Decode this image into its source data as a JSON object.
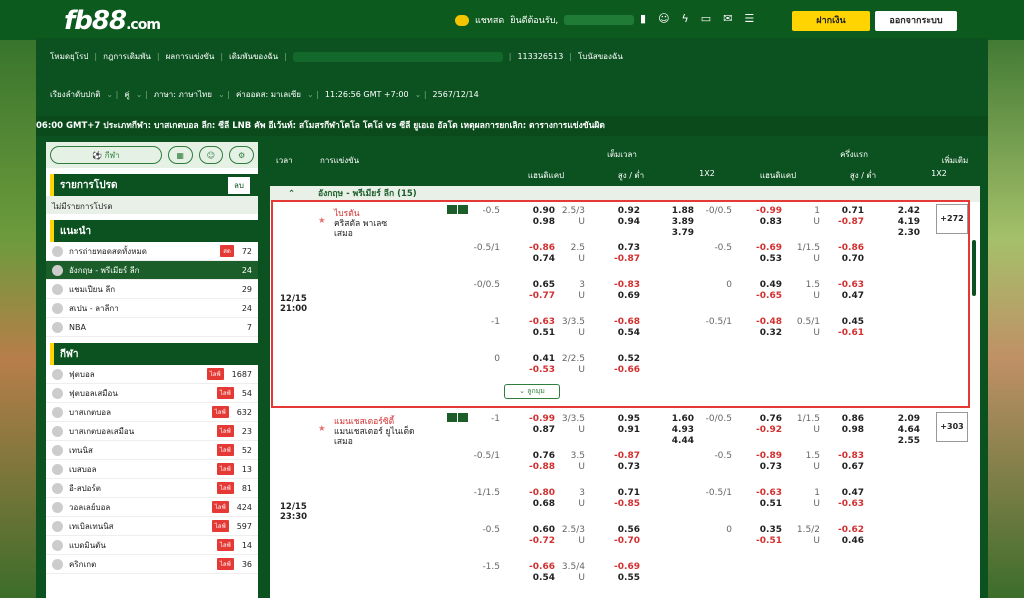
{
  "header": {
    "logo": "fb88",
    "logo_suffix": ".com",
    "chat": "แชทสด",
    "greeting": "ยินดีต้อนรับ,",
    "deposit": "ฝากเงิน",
    "logout": "ออกจากระบบ"
  },
  "nav1": [
    "โหมดยุโรป",
    "กฎการเดิมพัน",
    "ผลการแข่งขัน",
    "เดิมพันของฉัน",
    "113326513",
    "โบนัสของฉัน"
  ],
  "nav2": [
    "เรียงลำดับปกติ",
    "คู่",
    "ภาษา: ภาษาไทย",
    "ค่าออดส: มาเลเซีย",
    "11:26:56 GMT +7:00",
    "2567/12/14"
  ],
  "ticker": "06:00 GMT+7 ประเภทกีฬา: บาสเกตบอล ลีก: ซีลี LNB คัพ อีเว้นท์: สโมสรกีฬาโคโล โคโล่ vs ซีลี ยูเอเอ อัลโต เหตุผลการยกเลิก: ตารางการแข่งขันผิด",
  "sidebar": {
    "sport_btn": "กีฬา",
    "favorites_title": "รายการโปรด",
    "delete": "ลบ",
    "no_favorites": "ไม่มีรายการโปรด",
    "recommend_title": "แนะนำ",
    "recommend": [
      {
        "label": "การถ่ายทอดสดทั้งหมด",
        "tag": "สด",
        "count": "72"
      },
      {
        "label": "อังกฤษ - พรีเมียร์ ลีก",
        "count": "24"
      },
      {
        "label": "แชมเปียน ลีก",
        "count": "29"
      },
      {
        "label": "สเปน - ลาลีกา",
        "count": "24"
      },
      {
        "label": "NBA",
        "count": "7"
      }
    ],
    "sports_title": "กีฬา",
    "sports": [
      {
        "label": "ฟุตบอล",
        "tag": "ไลฟ์",
        "count": "1687"
      },
      {
        "label": "ฟุตบอลเสมือน",
        "tag": "ไลฟ์",
        "count": "54"
      },
      {
        "label": "บาสเกตบอล",
        "tag": "ไลฟ์",
        "count": "632"
      },
      {
        "label": "บาสเกตบอลเสมือน",
        "tag": "ไลฟ์",
        "count": "23"
      },
      {
        "label": "เทนนิส",
        "tag": "ไลฟ์",
        "count": "52"
      },
      {
        "label": "เบสบอล",
        "tag": "ไลฟ์",
        "count": "13"
      },
      {
        "label": "อี-สปอร์ต",
        "tag": "ไลฟ์",
        "count": "81"
      },
      {
        "label": "วอลเลย์บอล",
        "tag": "ไลฟ์",
        "count": "424"
      },
      {
        "label": "เทเบิลเทนนิส",
        "tag": "ไลฟ์",
        "count": "597"
      },
      {
        "label": "แบดมินตัน",
        "tag": "ไลฟ์",
        "count": "14"
      },
      {
        "label": "คริกเกต",
        "tag": "ไลฟ์",
        "count": "36"
      }
    ]
  },
  "table": {
    "time": "เวลา",
    "match": "การแข่งขัน",
    "fulltime": "เต็มเวลา",
    "halftime": "ครึ่งแรก",
    "more": "เพิ่มเติม",
    "hdp": "แฮนดิแคป",
    "ou": "สูง / ต่ำ",
    "x12": "1X2",
    "league": "อังกฤษ - พรีเมียร์ ลีก (15)",
    "more_btn": "ลูกมุม"
  },
  "match1": {
    "date": "12/15",
    "time": "21:00",
    "home": "ไบรตัน",
    "away": "คริสตัล พาเลซ",
    "draw": "เสมอ",
    "plus": "+272",
    "rows": [
      [
        "-0.5",
        "0.90",
        "0.98",
        "2.5/3",
        "U",
        "0.92",
        "0.94",
        "1.88",
        "3.89",
        "3.79",
        "-0/0.5",
        "-0.99",
        "0.83",
        "1",
        "U",
        "0.71",
        "-0.87",
        "2.42",
        "4.19",
        "2.30"
      ],
      [
        "-0.5/1",
        "-0.86",
        "0.74",
        "2.5",
        "U",
        "0.73",
        "-0.87",
        "",
        "",
        "",
        "-0.5",
        "-0.69",
        "0.53",
        "1/1.5",
        "U",
        "-0.86",
        "0.70",
        "",
        "",
        ""
      ],
      [
        "-0/0.5",
        "0.65",
        "-0.77",
        "3",
        "U",
        "-0.83",
        "0.69",
        "",
        "",
        "",
        "0",
        "0.49",
        "-0.65",
        "1.5",
        "U",
        "-0.63",
        "0.47",
        "",
        "",
        ""
      ],
      [
        "-1",
        "-0.63",
        "0.51",
        "3/3.5",
        "U",
        "-0.68",
        "0.54",
        "",
        "",
        "",
        "-0.5/1",
        "-0.48",
        "0.32",
        "0.5/1",
        "U",
        "0.45",
        "-0.61",
        "",
        "",
        ""
      ],
      [
        "0",
        "0.41",
        "-0.53",
        "2/2.5",
        "U",
        "0.52",
        "-0.66",
        "",
        "",
        "",
        "",
        "",
        "",
        "",
        "",
        "",
        "",
        "",
        "",
        ""
      ]
    ]
  },
  "match2": {
    "date": "12/15",
    "time": "23:30",
    "home": "แมนเชสเตอร์ซิตี้",
    "away": "แมนเชสเตอร์ ยูไนเต็ด",
    "draw": "เสมอ",
    "plus": "+303",
    "rows": [
      [
        "-1",
        "-0.99",
        "0.87",
        "3/3.5",
        "U",
        "0.95",
        "0.91",
        "1.60",
        "4.93",
        "4.44",
        "-0/0.5",
        "0.76",
        "-0.92",
        "1/1.5",
        "U",
        "0.86",
        "0.98",
        "2.09",
        "4.64",
        "2.55"
      ],
      [
        "-0.5/1",
        "0.76",
        "-0.88",
        "3.5",
        "U",
        "-0.87",
        "0.73",
        "",
        "",
        "",
        "-0.5",
        "-0.89",
        "0.73",
        "1.5",
        "U",
        "-0.83",
        "0.67",
        "",
        "",
        ""
      ],
      [
        "-1/1.5",
        "-0.80",
        "0.68",
        "3",
        "U",
        "0.71",
        "-0.85",
        "",
        "",
        "",
        "-0.5/1",
        "-0.63",
        "0.51",
        "1",
        "U",
        "0.47",
        "-0.63",
        "",
        "",
        ""
      ],
      [
        "-0.5",
        "0.60",
        "-0.72",
        "2.5/3",
        "U",
        "0.56",
        "-0.70",
        "",
        "",
        "",
        "0",
        "0.35",
        "-0.51",
        "1.5/2",
        "U",
        "-0.62",
        "0.46",
        "",
        "",
        ""
      ],
      [
        "-1.5",
        "-0.66",
        "0.54",
        "3.5/4",
        "U",
        "-0.69",
        "0.55",
        "",
        "",
        "",
        "",
        "",
        "",
        "",
        "",
        "",
        "",
        "",
        "",
        ""
      ]
    ]
  }
}
